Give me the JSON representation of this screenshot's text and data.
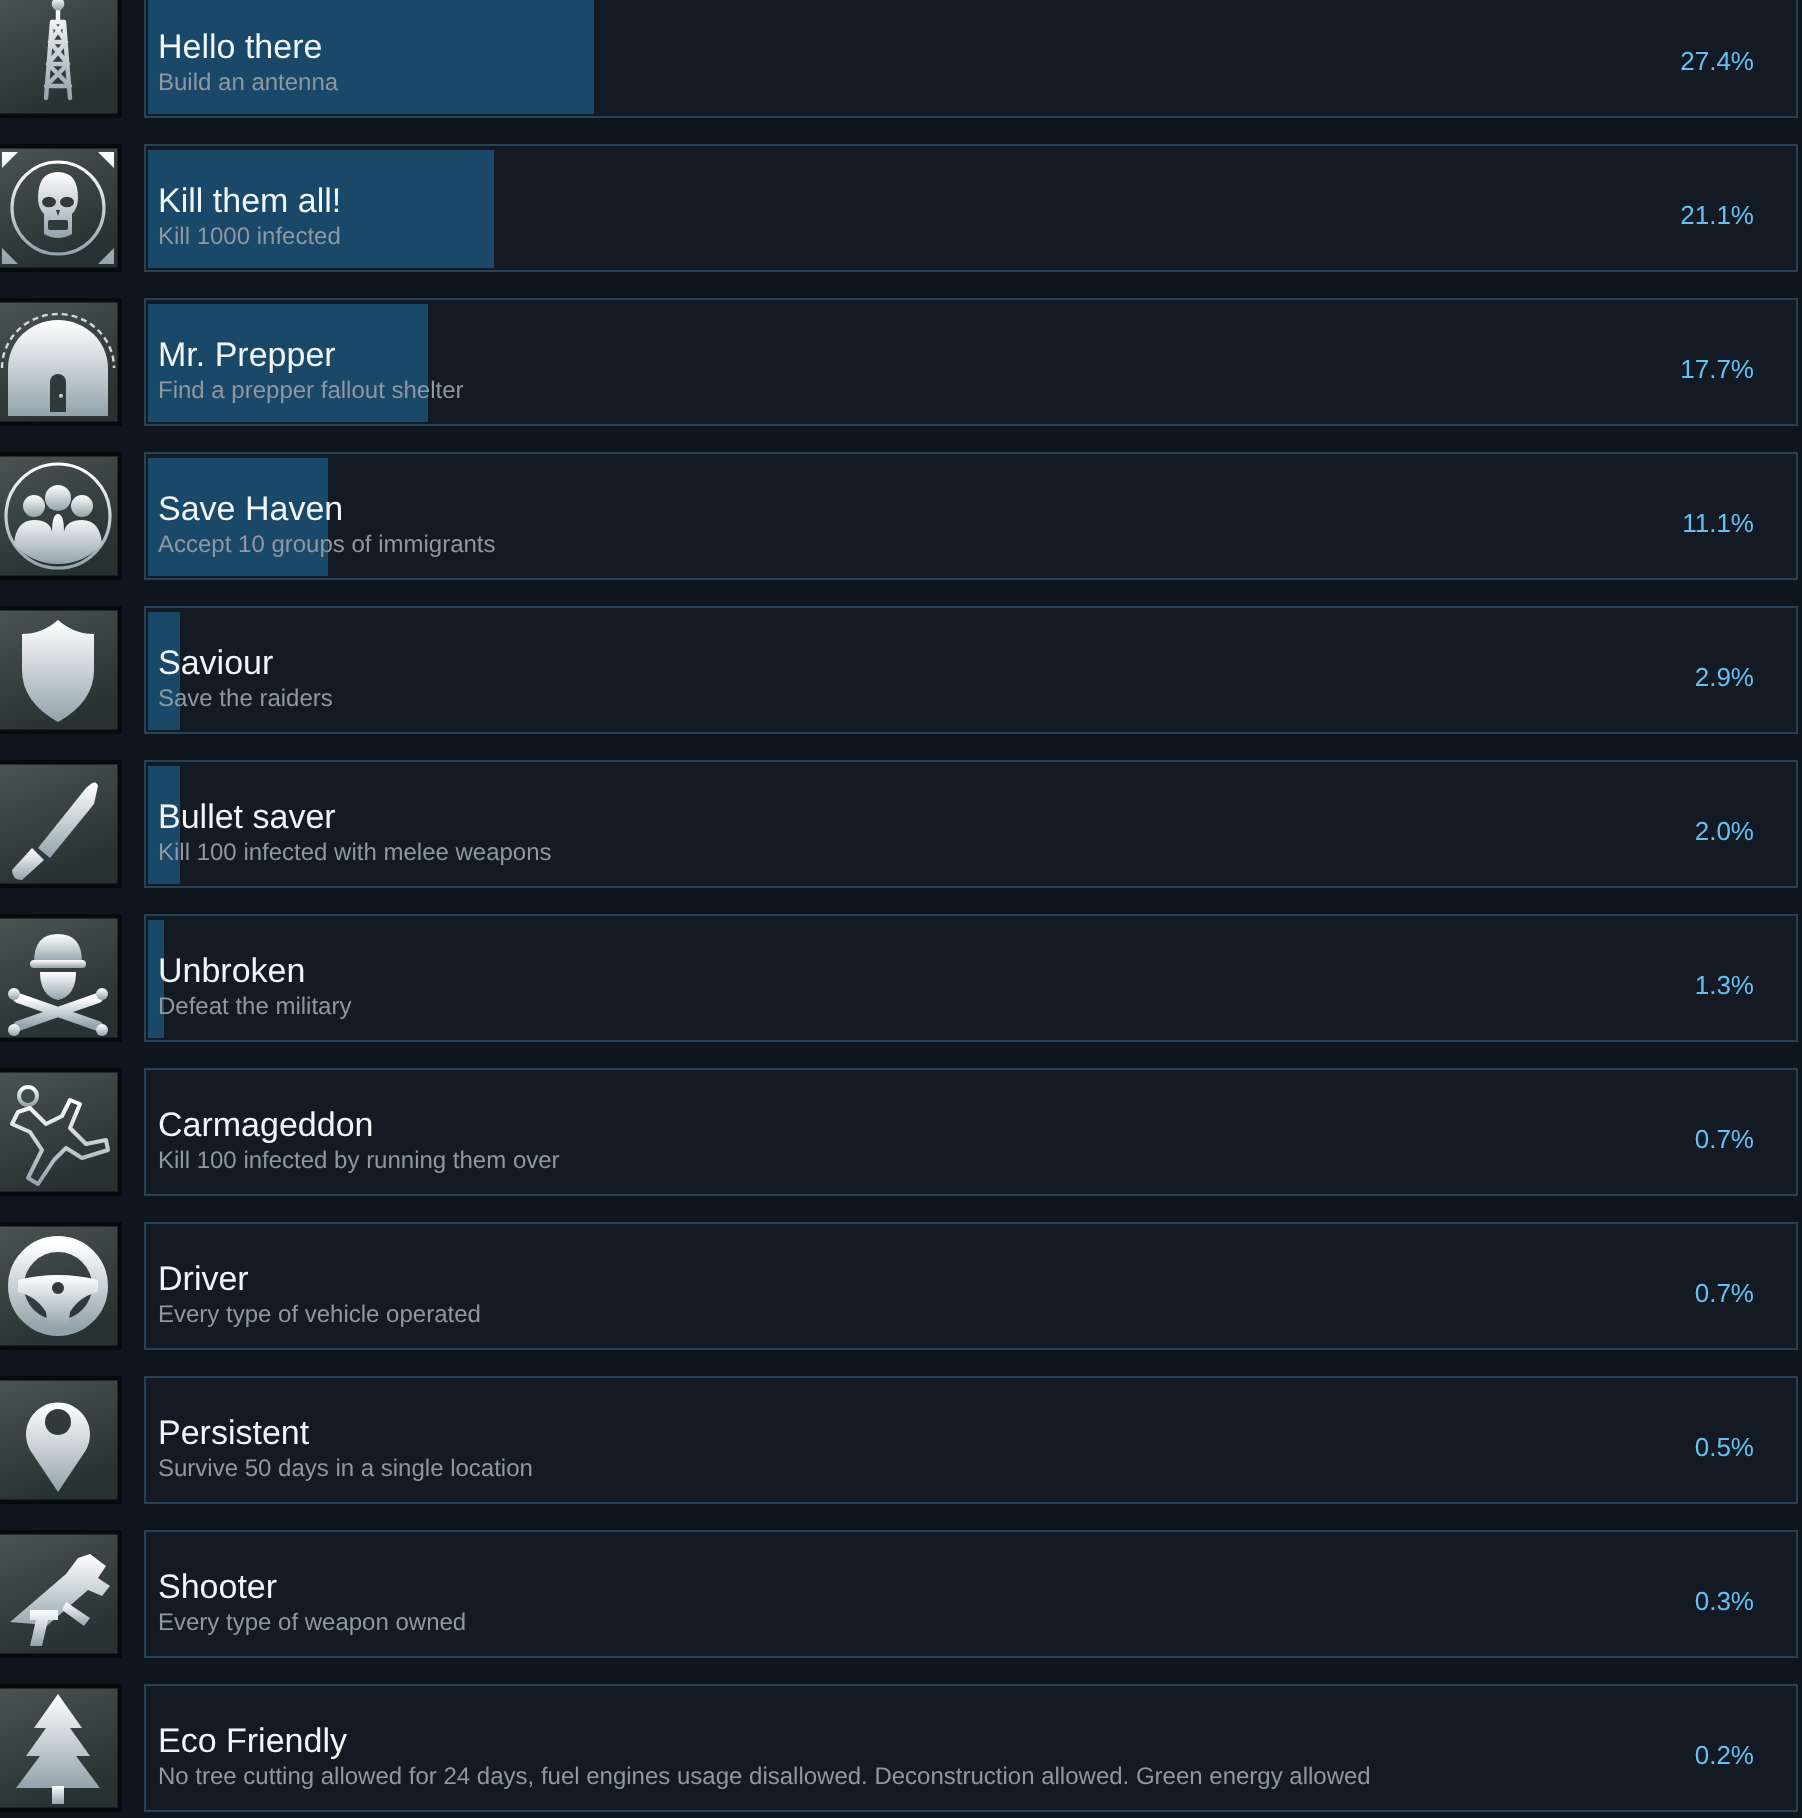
{
  "achievements": [
    {
      "title": "Hello there",
      "description": "Build an antenna",
      "percent": "27.4%",
      "level": 0.271
    },
    {
      "title": "Kill them all!",
      "description": "Kill 1000 infected",
      "percent": "21.1%",
      "level": 0.21
    },
    {
      "title": "Mr. Prepper",
      "description": "Find a prepper fallout shelter",
      "percent": "17.7%",
      "level": 0.17
    },
    {
      "title": "Save Haven",
      "description": "Accept 10 groups of immigrants",
      "percent": "11.1%",
      "level": 0.109
    },
    {
      "title": "Saviour",
      "description": "Save the raiders",
      "percent": "2.9%",
      "level": 0.019
    },
    {
      "title": "Bullet saver",
      "description": "Kill 100 infected with melee weapons",
      "percent": "2.0%",
      "level": 0.019
    },
    {
      "title": "Unbroken",
      "description": "Defeat the military",
      "percent": "1.3%",
      "level": 0.01
    },
    {
      "title": "Carmageddon",
      "description": "Kill 100 infected by running them over",
      "percent": "0.7%"
    },
    {
      "title": "Driver",
      "description": "Every type of vehicle operated",
      "percent": "0.7%"
    },
    {
      "title": "Persistent",
      "description": "Survive 50 days in a single location",
      "percent": "0.5%"
    },
    {
      "title": "Shooter",
      "description": "Every type of weapon owned",
      "percent": "0.3%"
    },
    {
      "title": "Eco Friendly",
      "description": "No tree cutting allowed for 24 days, fuel engines usage disallowed. Deconstruction allowed. Green energy allowed",
      "percent": "0.2%"
    }
  ]
}
